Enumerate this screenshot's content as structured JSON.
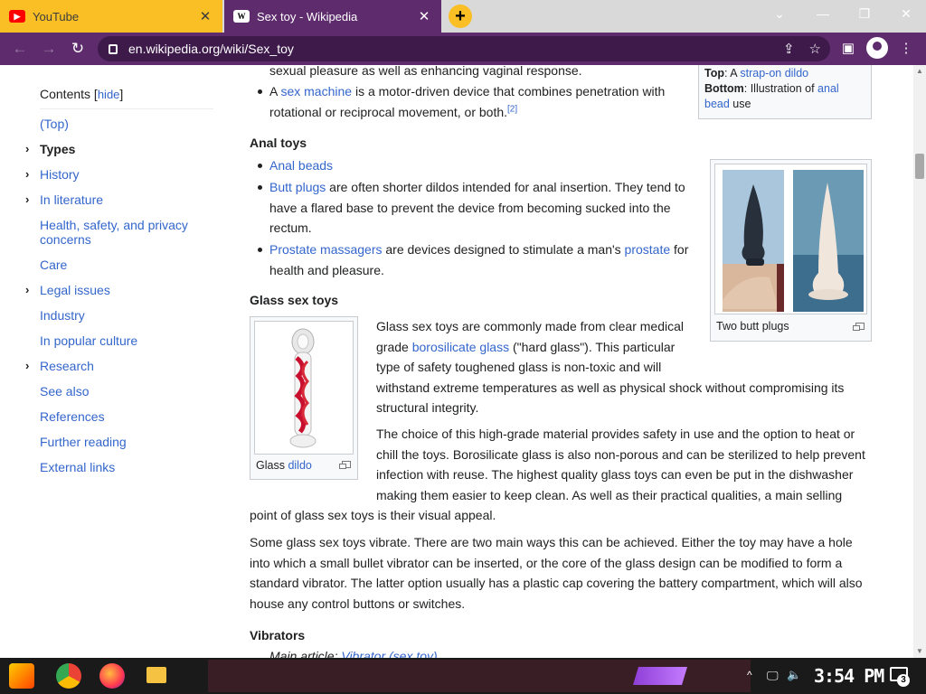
{
  "browser": {
    "tabs": [
      {
        "title": "YouTube",
        "favicon": "youtube-icon"
      },
      {
        "title": "Sex toy - Wikipedia",
        "favicon": "W"
      }
    ],
    "url_host": "en.wikipedia.org",
    "url_path": "/wiki/Sex_toy",
    "accent_color": "#5e2b6d",
    "tab_accent_color": "#f9bf24"
  },
  "toc": {
    "title": "Contents",
    "hide": "hide",
    "items": [
      {
        "label": "(Top)",
        "expandable": false
      },
      {
        "label": "Types",
        "expandable": true,
        "current": true
      },
      {
        "label": "History",
        "expandable": true
      },
      {
        "label": "In literature",
        "expandable": true
      },
      {
        "label": "Health, safety, and privacy concerns",
        "expandable": false
      },
      {
        "label": "Care",
        "expandable": false
      },
      {
        "label": "Legal issues",
        "expandable": true
      },
      {
        "label": "Industry",
        "expandable": false
      },
      {
        "label": "In popular culture",
        "expandable": false
      },
      {
        "label": "Research",
        "expandable": true
      },
      {
        "label": "See also",
        "expandable": false
      },
      {
        "label": "References",
        "expandable": false
      },
      {
        "label": "Further reading",
        "expandable": false
      },
      {
        "label": "External links",
        "expandable": false
      }
    ]
  },
  "article": {
    "top_text": "sexual pleasure as well as enhancing vaginal response.",
    "sex_machine": {
      "pre": "A ",
      "link": "sex machine",
      "post1": " is a motor-driven device that combines penetration with",
      "post2": "rotational or reciprocal movement, or both.",
      "ref": "[2]"
    },
    "top_caption": {
      "top_label": "Top",
      "top_sep": ": A ",
      "top_link": "strap-on dildo",
      "bottom_label": "Bottom",
      "bottom_sep": ": Illustration of ",
      "bottom_link1": "anal",
      "bottom_link2": "bead",
      "bottom_tail": " use"
    },
    "anal_heading": "Anal toys",
    "anal_beads": "Anal beads",
    "butt_plugs": {
      "link": "Butt plugs",
      "l1": " are often shorter dildos intended for anal insertion. They tend to",
      "l2": "have a flared base to prevent the device from becoming sucked into the",
      "l3": "rectum."
    },
    "prostate": {
      "link": "Prostate massagers",
      "mid": " are devices designed to stimulate a man's ",
      "link2": "prostate",
      "tail": " for",
      "l2": "health and pleasure."
    },
    "butt_plug_caption": "Two butt plugs",
    "glass_heading": "Glass sex toys",
    "glass_caption_pre": "Glass ",
    "glass_caption_link": "dildo",
    "glass_p1": {
      "l1": "Glass sex toys are commonly made from clear medical",
      "l2_pre": "grade ",
      "l2_link": "borosilicate glass",
      "l2_post": " (\"hard glass\"). This particular",
      "l3": "type of safety toughened glass is non-toxic and will",
      "l4": "withstand extreme temperatures as well as physical shock without compromising its",
      "l5": "structural integrity."
    },
    "glass_p2": [
      "The choice of this high-grade material provides safety in use and the option to heat or",
      "chill the toys. Borosilicate glass is also non-porous and can be sterilized to help prevent",
      "infection with reuse. The highest quality glass toys can even be put in the dishwasher",
      "making them easier to keep clean. As well as their practical qualities, a main selling",
      "point of glass sex toys is their visual appeal."
    ],
    "glass_p3": [
      "Some glass sex toys vibrate. There are two main ways this can be achieved. Either the toy may have a hole",
      "into which a small bullet vibrator can be inserted, or the core of the glass design can be modified to form a",
      "standard vibrator. The latter option usually has a plastic cap covering the battery compartment, which will also",
      "house any control buttons or switches."
    ],
    "vibrators_heading": "Vibrators",
    "main_article_pre": "Main article: ",
    "main_article_link": "Vibrator (sex toy)"
  },
  "taskbar": {
    "clock": "3:54 PM",
    "notification_count": "3"
  }
}
